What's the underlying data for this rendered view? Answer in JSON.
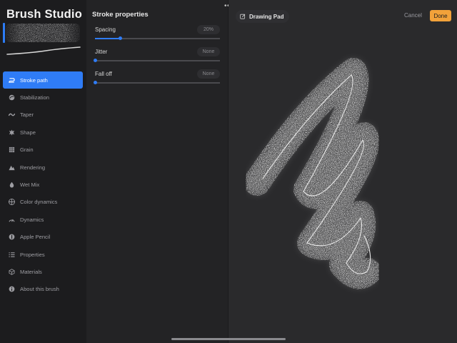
{
  "app": {
    "title": "Brush Studio"
  },
  "sidebar": {
    "items": [
      {
        "label": "Stroke path",
        "icon": "stroke-path-icon",
        "active": true
      },
      {
        "label": "Stabilization",
        "icon": "stabilization-icon"
      },
      {
        "label": "Taper",
        "icon": "taper-icon"
      },
      {
        "label": "Shape",
        "icon": "shape-icon"
      },
      {
        "label": "Grain",
        "icon": "grain-icon"
      },
      {
        "label": "Rendering",
        "icon": "rendering-icon"
      },
      {
        "label": "Wet Mix",
        "icon": "wet-mix-icon"
      },
      {
        "label": "Color dynamics",
        "icon": "color-dynamics-icon"
      },
      {
        "label": "Dynamics",
        "icon": "dynamics-icon"
      },
      {
        "label": "Apple Pencil",
        "icon": "apple-pencil-icon"
      },
      {
        "label": "Properties",
        "icon": "properties-icon"
      },
      {
        "label": "Materials",
        "icon": "materials-icon"
      },
      {
        "label": "About this brush",
        "icon": "info-icon"
      }
    ]
  },
  "panel": {
    "title": "Stroke properties",
    "properties": [
      {
        "label": "Spacing",
        "value": "20%",
        "level": 0.2
      },
      {
        "label": "Jitter",
        "value": "None",
        "level": 0
      },
      {
        "label": "Fall off",
        "value": "None",
        "level": 0
      }
    ]
  },
  "pad": {
    "label": "Drawing Pad",
    "cancel": "Cancel",
    "done": "Done"
  },
  "colors": {
    "accent": "#2f7cf6",
    "done": "#f2a23a",
    "sidebar_bg": "#1c1c1e",
    "panel_bg": "#232325",
    "pad_bg": "#2a2a2c"
  }
}
